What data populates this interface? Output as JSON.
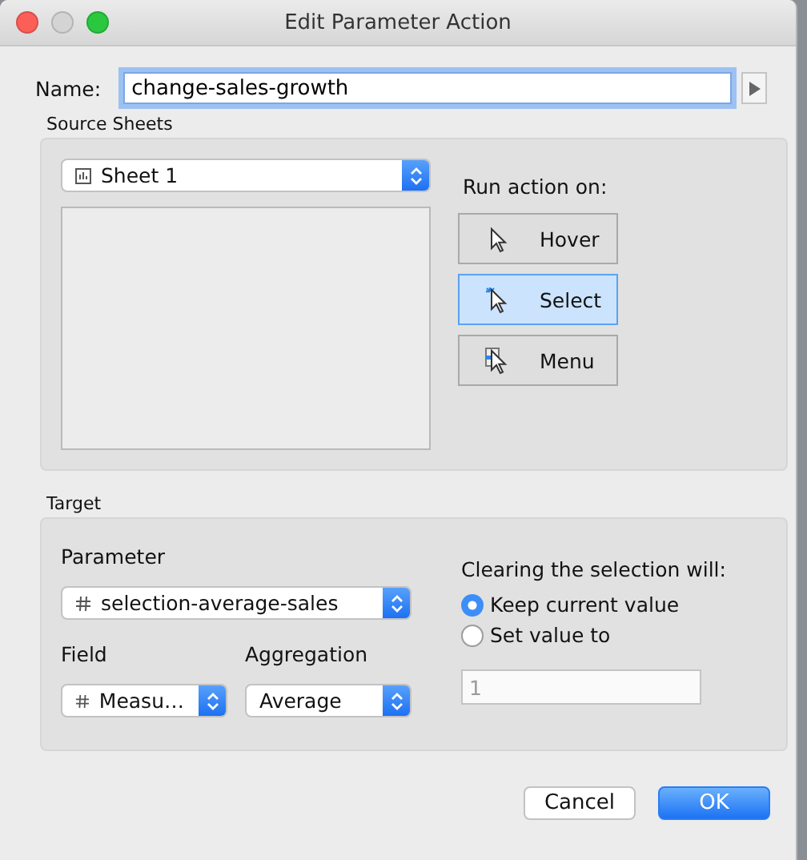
{
  "window": {
    "title": "Edit Parameter Action"
  },
  "name_field": {
    "label": "Name:",
    "value": "change-sales-growth"
  },
  "source_sheets": {
    "title": "Source Sheets",
    "sheet_dropdown": {
      "value": "Sheet 1"
    },
    "run_action": {
      "label": "Run action on:",
      "options": [
        {
          "kind": "hover",
          "label": "Hover",
          "selected": false
        },
        {
          "kind": "select",
          "label": "Select",
          "selected": true
        },
        {
          "kind": "menu",
          "label": "Menu",
          "selected": false
        }
      ]
    }
  },
  "target": {
    "title": "Target",
    "parameter": {
      "label": "Parameter",
      "value": "selection-average-sales"
    },
    "field": {
      "label": "Field",
      "value": "Measu…"
    },
    "aggregation": {
      "label": "Aggregation",
      "value": "Average"
    },
    "clearing": {
      "label": "Clearing the selection will:",
      "options": [
        {
          "label": "Keep current value",
          "selected": true
        },
        {
          "label": "Set value to",
          "selected": false
        }
      ],
      "value_field": {
        "value": "1",
        "disabled": true
      }
    }
  },
  "buttons": [
    {
      "kind": "cancel",
      "label": "Cancel"
    },
    {
      "kind": "ok",
      "label": "OK"
    }
  ]
}
